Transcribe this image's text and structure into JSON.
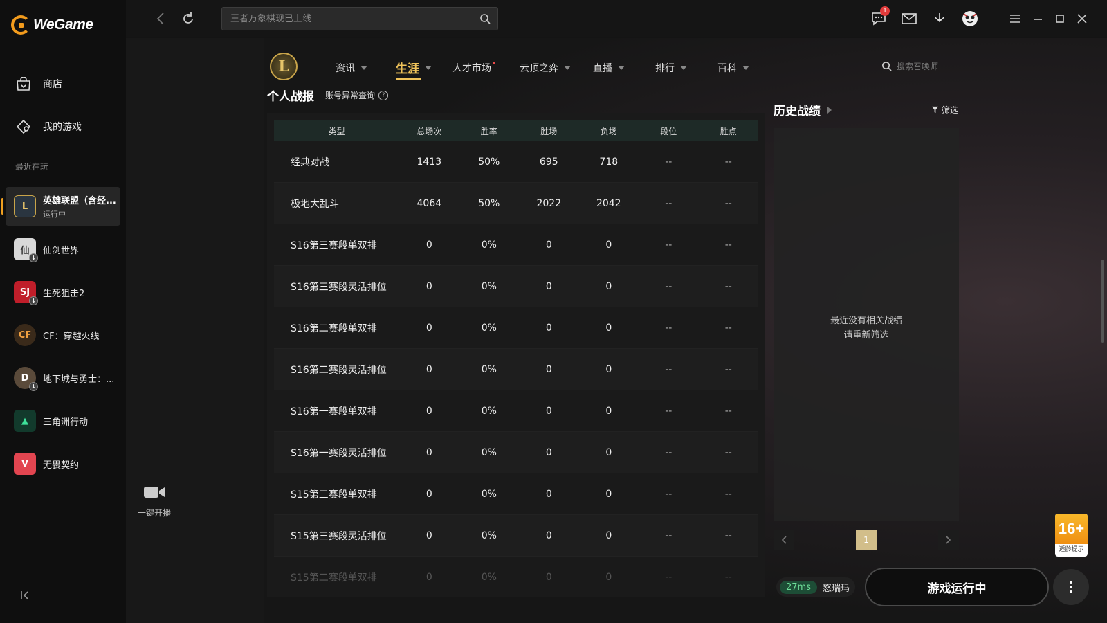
{
  "app": {
    "logo_text": "WeGame"
  },
  "sidebar": {
    "nav": [
      {
        "label": "商店",
        "icon": "store-icon"
      },
      {
        "label": "我的游戏",
        "icon": "my-games-icon"
      }
    ],
    "section_label": "最近在玩",
    "games": [
      {
        "name": "英雄联盟（含经...",
        "status": "运行中",
        "icon_text": "L",
        "color": "#2a3540"
      },
      {
        "name": "仙剑世界",
        "icon_text": "仙",
        "color": "#d8d8d8"
      },
      {
        "name": "生死狙击2",
        "icon_text": "SJ",
        "color": "#c01e2a"
      },
      {
        "name": "CF：穿越火线",
        "icon_text": "CF",
        "color": "#3a2a1a"
      },
      {
        "name": "地下城与勇士：...",
        "icon_text": "D",
        "color": "#5a4a3a"
      },
      {
        "name": "三角洲行动",
        "icon_text": "▲",
        "color": "#123a2c"
      },
      {
        "name": "无畏契约",
        "icon_text": "V",
        "color": "#e24550"
      }
    ]
  },
  "strip": {
    "live_label": "一键开播"
  },
  "topbar": {
    "search_placeholder": "王者万象棋现已上线",
    "notification_count": "1"
  },
  "nav_tabs": [
    {
      "label": "资讯",
      "caret": true
    },
    {
      "label": "生涯",
      "caret": true,
      "active": true
    },
    {
      "label": "人才市场",
      "dot": true
    },
    {
      "label": "云顶之弈",
      "caret": true
    },
    {
      "label": "直播",
      "caret": true
    },
    {
      "label": "排行",
      "caret": true
    },
    {
      "label": "百科",
      "caret": true
    }
  ],
  "summoner_search_placeholder": "搜索召唤师",
  "page": {
    "title": "个人战报",
    "abnormal_link": "账号异常查询",
    "help": "?"
  },
  "table": {
    "headers": [
      "类型",
      "总场次",
      "胜率",
      "胜场",
      "负场",
      "段位",
      "胜点"
    ],
    "rows": [
      [
        "经典对战",
        "1413",
        "50%",
        "695",
        "718",
        "--",
        "--"
      ],
      [
        "极地大乱斗",
        "4064",
        "50%",
        "2022",
        "2042",
        "--",
        "--"
      ],
      [
        "S16第三赛段单双排",
        "0",
        "0%",
        "0",
        "0",
        "--",
        "--"
      ],
      [
        "S16第三赛段灵活排位",
        "0",
        "0%",
        "0",
        "0",
        "--",
        "--"
      ],
      [
        "S16第二赛段单双排",
        "0",
        "0%",
        "0",
        "0",
        "--",
        "--"
      ],
      [
        "S16第二赛段灵活排位",
        "0",
        "0%",
        "0",
        "0",
        "--",
        "--"
      ],
      [
        "S16第一赛段单双排",
        "0",
        "0%",
        "0",
        "0",
        "--",
        "--"
      ],
      [
        "S16第一赛段灵活排位",
        "0",
        "0%",
        "0",
        "0",
        "--",
        "--"
      ],
      [
        "S15第三赛段单双排",
        "0",
        "0%",
        "0",
        "0",
        "--",
        "--"
      ],
      [
        "S15第三赛段灵活排位",
        "0",
        "0%",
        "0",
        "0",
        "--",
        "--"
      ],
      [
        "S15第二赛段单双排",
        "0",
        "0%",
        "0",
        "0",
        "--",
        "--"
      ]
    ]
  },
  "history": {
    "title": "历史战绩",
    "filter_label": "筛选",
    "empty_line1": "最近没有相关战绩",
    "empty_line2": "请重新筛选",
    "page": "1"
  },
  "bottom": {
    "ping": "27ms",
    "ping_label": "怒瑞玛",
    "launch_label": "游戏运行中"
  },
  "age_badge": {
    "rating": "16+",
    "label": "适龄提示"
  },
  "colors": {
    "accent": "#f0c35a",
    "brand": "#f29b1d",
    "ping_green": "#6fe09a"
  }
}
